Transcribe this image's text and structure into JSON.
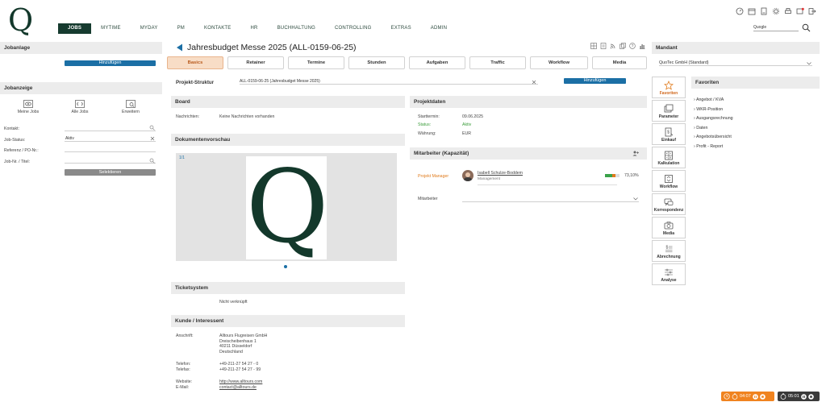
{
  "brand": {
    "logo_letter": "Q"
  },
  "nav": [
    {
      "label": "JOBS",
      "active": true
    },
    {
      "label": "MYTIME"
    },
    {
      "label": "MYDAY"
    },
    {
      "label": "PM"
    },
    {
      "label": "KONTAKTE"
    },
    {
      "label": "HR"
    },
    {
      "label": "BUCHHALTUNG"
    },
    {
      "label": "CONTROLLING"
    },
    {
      "label": "EXTRAS"
    },
    {
      "label": "ADMIN"
    }
  ],
  "search": {
    "value": "Quogle"
  },
  "left": {
    "jobanlage_title": "Jobanlage",
    "add_label": "Hinzufügen",
    "jobanzeige_title": "Jobanzeige",
    "views": [
      {
        "label": "Meine Jobs",
        "icon": "eye-icon"
      },
      {
        "label": "Alle Jobs",
        "icon": "code-icon"
      },
      {
        "label": "Erweitern",
        "icon": "search-list-icon"
      }
    ],
    "filters": {
      "kontakt_label": "Kontakt:",
      "status_label": "Job-Status:",
      "status_value": "Aktiv",
      "referenz_label": "Referenz / PO-Nr.:",
      "jobnr_label": "Job-Nr. / Titel:"
    },
    "select_label": "Selektieren"
  },
  "main": {
    "title": "Jahresbudget Messe 2025 (ALL-0159-06-25)",
    "tabs": [
      "Basics",
      "Retainer",
      "Termine",
      "Stunden",
      "Aufgaben",
      "Traffic",
      "Workflow",
      "Media"
    ],
    "active_tab": "Basics",
    "projekt_struktur_label": "Projekt-Struktur",
    "projekt_struktur_value": "ALL-0159-06-25 (Jahresbudget Messe 2025)",
    "add_label": "Hinzufügen",
    "board": {
      "title": "Board",
      "nachrichten_label": "Nachrichten:",
      "nachrichten_value": "Keine Nachrichten vorhanden"
    },
    "dokumentenvorschau": {
      "title": "Dokumentenvorschau",
      "page_counter": "1/1",
      "preview_letter": "Q"
    },
    "ticketsystem": {
      "title": "Ticketsystem",
      "value": "Nicht verknüpft"
    },
    "kunde": {
      "title": "Kunde / Interessent",
      "anschrift_label": "Anschrift:",
      "anschrift_lines": [
        "Alltours Flugreisen GmbH",
        "Dreischeibenhaus 1",
        "40211 Düsseldorf",
        "Deutschland"
      ],
      "telefon_label": "Telefon:",
      "telefon_value": "+49-211-27 54 27 - 0",
      "telefax_label": "Telefax:",
      "telefax_value": "+49-211-27 54 27 - 99",
      "website_label": "Website:",
      "website_value": "http://www.alltours.com",
      "email_label": "E-Mail:",
      "email_value": "contact@alltours.de"
    },
    "projektdaten": {
      "title": "Projektdaten",
      "starttermin_label": "Starttermin:",
      "starttermin_value": "09.06.2025",
      "status_label": "Status:",
      "status_value": "Aktiv",
      "waehrung_label": "Währung:",
      "waehrung_value": "EUR"
    },
    "mitarbeiter": {
      "title": "Mitarbeiter (Kapazität)",
      "role": "Projekt Manager",
      "name": "Isabell Schulze-Boddem",
      "department": "Management",
      "capacity_text": "73,10%",
      "capacity_fraction": 0.731,
      "mitarbeiter_label": "Mitarbeiter"
    }
  },
  "right": {
    "mandant_title": "Mandant",
    "mandant_value": "QuoTec GmbH (Standard)",
    "tiles": [
      {
        "label": "Favoriten",
        "icon": "star-icon",
        "active": true
      },
      {
        "label": "Parameter",
        "icon": "parameter-icon"
      },
      {
        "label": "Einkauf",
        "icon": "einkauf-icon"
      },
      {
        "label": "Kalkulation",
        "icon": "calculator-icon"
      },
      {
        "label": "Workflow",
        "icon": "workflow-icon"
      },
      {
        "label": "Korrespondenz",
        "icon": "chat-icon"
      },
      {
        "label": "Media",
        "icon": "camera-icon"
      },
      {
        "label": "Abrechnung",
        "icon": "invoice-icon"
      },
      {
        "label": "Analyse",
        "icon": "analyse-icon"
      }
    ],
    "favoriten_title": "Favoriten",
    "favorites": [
      "Angebot / KVA",
      "WKR-Position",
      "Ausgangsrechnung",
      "Daten",
      "Angebotsübersicht",
      "Profit - Report"
    ]
  },
  "timers": {
    "orange_time": "04:07",
    "dark_time": "05:01",
    "colors": {
      "orange": "#f0831f",
      "dark": "#3a3a3a"
    }
  },
  "colors": {
    "brand": "#163b2f",
    "accent_blue": "#1b6fa5",
    "tab_active": "#f8ddc6"
  }
}
